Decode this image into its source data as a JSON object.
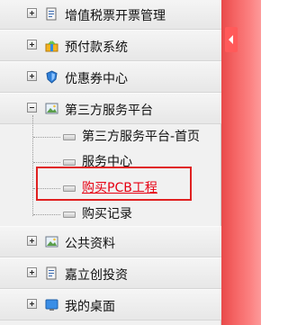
{
  "menu": {
    "items": [
      {
        "label": "增值税票开票管理",
        "state": "collapsed",
        "icon": "document-icon"
      },
      {
        "label": "预付款系统",
        "state": "collapsed",
        "icon": "gift-icon"
      },
      {
        "label": "优惠券中心",
        "state": "collapsed",
        "icon": "shield-icon"
      },
      {
        "label": "第三方服务平台",
        "state": "expanded",
        "icon": "image-icon",
        "children": [
          {
            "label": "第三方服务平台-首页",
            "selected": false
          },
          {
            "label": "服务中心",
            "selected": false
          },
          {
            "label": "购买PCB工程",
            "selected": true
          },
          {
            "label": "购买记录",
            "selected": false
          }
        ]
      },
      {
        "label": "公共资料",
        "state": "collapsed",
        "icon": "image-icon"
      },
      {
        "label": "嘉立创投资",
        "state": "collapsed",
        "icon": "document-icon"
      },
      {
        "label": "我的桌面",
        "state": "collapsed",
        "icon": "desktop-icon"
      }
    ]
  },
  "colors": {
    "link_active": "#e60012",
    "highlight_border": "#e02020",
    "side_strip": "#f56565"
  },
  "collapse_toggle_icon": "chevron-left-icon"
}
